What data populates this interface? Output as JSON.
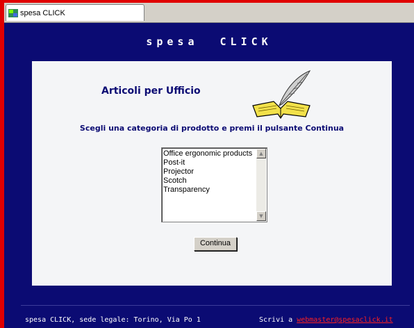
{
  "window": {
    "tab_title": "spesa CLICK"
  },
  "header": {
    "title": "spesa  CLICK"
  },
  "main": {
    "section_title": "Articoli per Ufficio",
    "instruction": "Scegli una categoria di prodotto e premi il pulsante Continua",
    "categories": [
      "Office ergonomic products",
      "Post-it",
      "Projector",
      "Scotch",
      "Transparency"
    ],
    "continue_label": "Continua"
  },
  "footer": {
    "address": "spesa CLICK, sede legale: Torino, Via Po 1",
    "contact_prefix": "Scrivi a",
    "email": "webmaster@spesaclick.it"
  },
  "colors": {
    "page_background": "#0b0b73",
    "panel_background": "#f4f5f7",
    "frame_red": "#e00000",
    "link_red": "#ff2020"
  },
  "icons": [
    "tab-favicon-icon",
    "quill-book-icon",
    "scroll-up-icon",
    "scroll-down-icon"
  ]
}
